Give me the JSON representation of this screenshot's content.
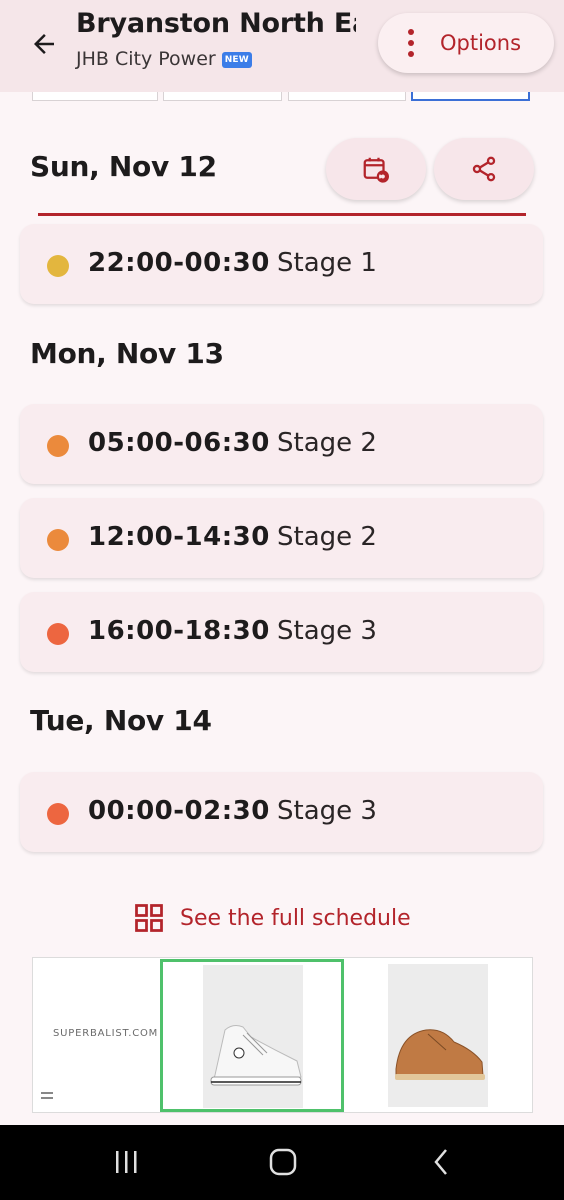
{
  "app_bar": {
    "title": "Bryanston North Ea",
    "subtitle": "JHB City Power",
    "badge": "NEW",
    "options_label": "Options",
    "accent_color": "#b3242b"
  },
  "days": [
    {
      "label": "Sun, Nov 12",
      "slots": [
        {
          "time": "22:00-00:30",
          "stage": "Stage 1",
          "color": "#e3b63e"
        }
      ]
    },
    {
      "label": "Mon, Nov 13",
      "slots": [
        {
          "time": "05:00-06:30",
          "stage": "Stage 2",
          "color": "#eb8a3c"
        },
        {
          "time": "12:00-14:30",
          "stage": "Stage 2",
          "color": "#eb8a3c"
        },
        {
          "time": "16:00-18:30",
          "stage": "Stage 3",
          "color": "#ed6640"
        }
      ]
    },
    {
      "label": "Tue, Nov 14",
      "slots": [
        {
          "time": "00:00-02:30",
          "stage": "Stage 3",
          "color": "#ed6640"
        }
      ]
    }
  ],
  "actions": {
    "full_schedule_label": "See the full schedule"
  },
  "ad": {
    "brand_text": "SUPERBALIST.COM"
  },
  "icons": {
    "back": "arrow-left-icon",
    "options": "more-vert-icon",
    "calendar": "calendar-refresh-icon",
    "share": "share-icon",
    "grid": "grid-icon"
  }
}
